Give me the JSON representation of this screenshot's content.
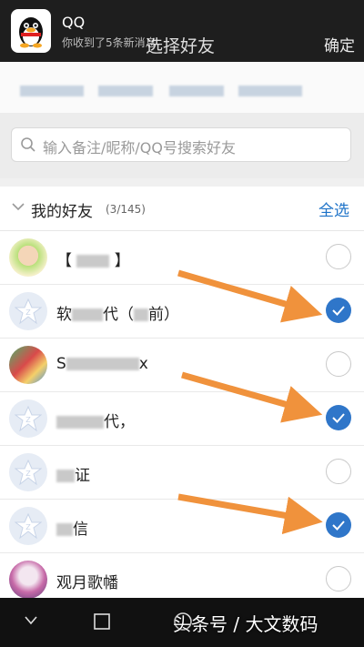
{
  "notification": {
    "app_name": "QQ",
    "message": "你收到了5条新消息"
  },
  "header": {
    "title": "选择好友",
    "confirm_label": "确定"
  },
  "search": {
    "placeholder": "输入备注/昵称/QQ号搜索好友"
  },
  "group": {
    "title": "我的好友",
    "count": "(3/145)",
    "select_all_label": "全选"
  },
  "friends": [
    {
      "name_prefix": "【 ",
      "name_suffix": " 】",
      "avatar": "photo-girl",
      "selected": false
    },
    {
      "name_prefix": "软",
      "name_suffix": "代（",
      "name_tail": "前）",
      "avatar": "default-qq",
      "selected": true
    },
    {
      "name_prefix": "S",
      "name_suffix": "x",
      "avatar": "photo-cartoon",
      "selected": false
    },
    {
      "name_prefix": "",
      "name_suffix": "代，",
      "avatar": "default-qq",
      "selected": true
    },
    {
      "name_prefix": "",
      "name_suffix": "证",
      "avatar": "default-qq",
      "selected": false
    },
    {
      "name_prefix": "",
      "name_suffix": "信",
      "avatar": "default-qq",
      "selected": true
    },
    {
      "name_prefix": "观月歌幡",
      "name_suffix": "",
      "avatar": "photo-anime",
      "selected": false
    }
  ],
  "watermark": "头条号 / 大文数码",
  "colors": {
    "accent_blue": "#2f76c9",
    "arrow_orange": "#f0923c"
  }
}
